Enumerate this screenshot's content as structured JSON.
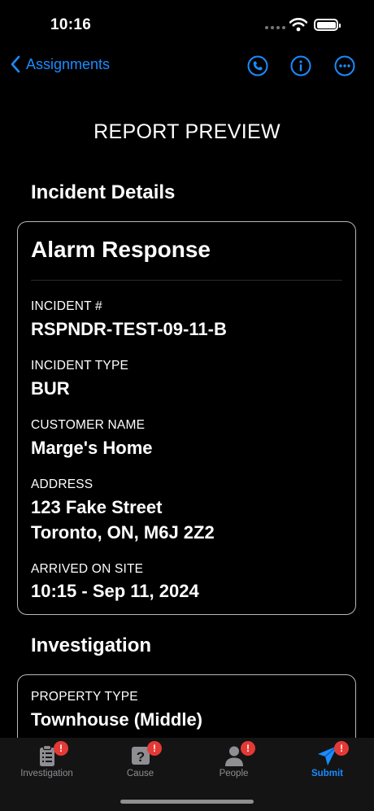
{
  "status_bar": {
    "time": "10:16"
  },
  "nav": {
    "back_label": "Assignments"
  },
  "page_title": "REPORT PREVIEW",
  "incident_details": {
    "section_title": "Incident Details",
    "card_title": "Alarm Response",
    "fields": [
      {
        "label": "INCIDENT #",
        "value": "RSPNDR-TEST-09-11-B"
      },
      {
        "label": "INCIDENT TYPE",
        "value": "BUR"
      },
      {
        "label": "CUSTOMER NAME",
        "value": "Marge's Home"
      },
      {
        "label": "ADDRESS",
        "value": "123 Fake Street\nToronto, ON, M6J 2Z2"
      },
      {
        "label": "ARRIVED ON SITE",
        "value": "10:15 - Sep 11, 2024"
      }
    ]
  },
  "investigation": {
    "section_title": "Investigation",
    "fields": [
      {
        "label": "PROPERTY TYPE",
        "value": "Townhouse (Middle)"
      }
    ]
  },
  "tabs": [
    {
      "label": "Investigation",
      "icon": "clipboard-icon",
      "badge": "!"
    },
    {
      "label": "Cause",
      "icon": "question-icon",
      "badge": "!"
    },
    {
      "label": "People",
      "icon": "person-icon",
      "badge": "!"
    },
    {
      "label": "Submit",
      "icon": "send-icon",
      "badge": "!"
    }
  ],
  "colors": {
    "accent": "#1a8cff",
    "badge": "#e53935",
    "background": "#000000"
  }
}
